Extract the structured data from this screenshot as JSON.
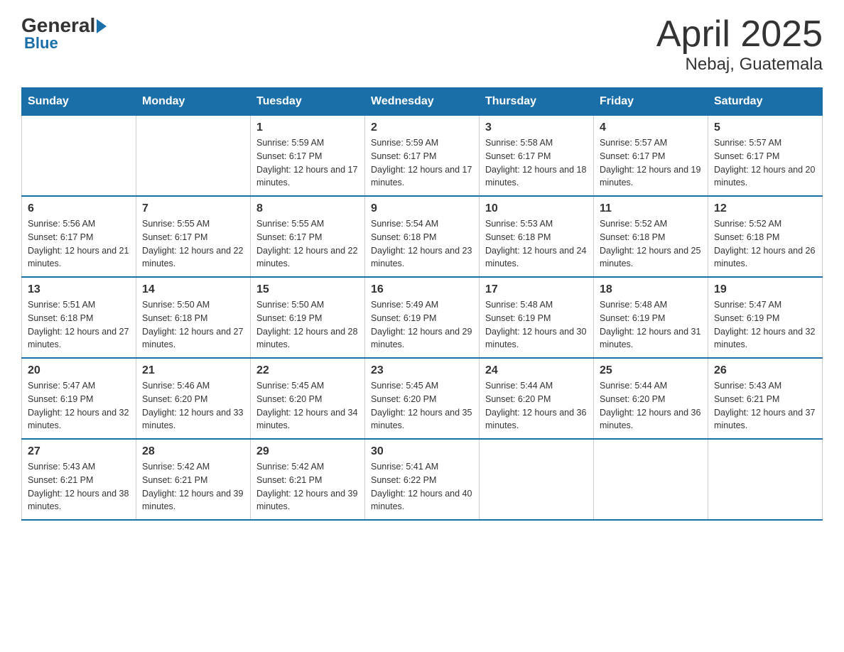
{
  "logo": {
    "general": "General",
    "blue": "Blue",
    "subtitle": "Blue"
  },
  "title": {
    "month": "April 2025",
    "location": "Nebaj, Guatemala"
  },
  "weekdays": [
    "Sunday",
    "Monday",
    "Tuesday",
    "Wednesday",
    "Thursday",
    "Friday",
    "Saturday"
  ],
  "weeks": [
    [
      {
        "day": "",
        "sunrise": "",
        "sunset": "",
        "daylight": ""
      },
      {
        "day": "",
        "sunrise": "",
        "sunset": "",
        "daylight": ""
      },
      {
        "day": "1",
        "sunrise": "Sunrise: 5:59 AM",
        "sunset": "Sunset: 6:17 PM",
        "daylight": "Daylight: 12 hours and 17 minutes."
      },
      {
        "day": "2",
        "sunrise": "Sunrise: 5:59 AM",
        "sunset": "Sunset: 6:17 PM",
        "daylight": "Daylight: 12 hours and 17 minutes."
      },
      {
        "day": "3",
        "sunrise": "Sunrise: 5:58 AM",
        "sunset": "Sunset: 6:17 PM",
        "daylight": "Daylight: 12 hours and 18 minutes."
      },
      {
        "day": "4",
        "sunrise": "Sunrise: 5:57 AM",
        "sunset": "Sunset: 6:17 PM",
        "daylight": "Daylight: 12 hours and 19 minutes."
      },
      {
        "day": "5",
        "sunrise": "Sunrise: 5:57 AM",
        "sunset": "Sunset: 6:17 PM",
        "daylight": "Daylight: 12 hours and 20 minutes."
      }
    ],
    [
      {
        "day": "6",
        "sunrise": "Sunrise: 5:56 AM",
        "sunset": "Sunset: 6:17 PM",
        "daylight": "Daylight: 12 hours and 21 minutes."
      },
      {
        "day": "7",
        "sunrise": "Sunrise: 5:55 AM",
        "sunset": "Sunset: 6:17 PM",
        "daylight": "Daylight: 12 hours and 22 minutes."
      },
      {
        "day": "8",
        "sunrise": "Sunrise: 5:55 AM",
        "sunset": "Sunset: 6:17 PM",
        "daylight": "Daylight: 12 hours and 22 minutes."
      },
      {
        "day": "9",
        "sunrise": "Sunrise: 5:54 AM",
        "sunset": "Sunset: 6:18 PM",
        "daylight": "Daylight: 12 hours and 23 minutes."
      },
      {
        "day": "10",
        "sunrise": "Sunrise: 5:53 AM",
        "sunset": "Sunset: 6:18 PM",
        "daylight": "Daylight: 12 hours and 24 minutes."
      },
      {
        "day": "11",
        "sunrise": "Sunrise: 5:52 AM",
        "sunset": "Sunset: 6:18 PM",
        "daylight": "Daylight: 12 hours and 25 minutes."
      },
      {
        "day": "12",
        "sunrise": "Sunrise: 5:52 AM",
        "sunset": "Sunset: 6:18 PM",
        "daylight": "Daylight: 12 hours and 26 minutes."
      }
    ],
    [
      {
        "day": "13",
        "sunrise": "Sunrise: 5:51 AM",
        "sunset": "Sunset: 6:18 PM",
        "daylight": "Daylight: 12 hours and 27 minutes."
      },
      {
        "day": "14",
        "sunrise": "Sunrise: 5:50 AM",
        "sunset": "Sunset: 6:18 PM",
        "daylight": "Daylight: 12 hours and 27 minutes."
      },
      {
        "day": "15",
        "sunrise": "Sunrise: 5:50 AM",
        "sunset": "Sunset: 6:19 PM",
        "daylight": "Daylight: 12 hours and 28 minutes."
      },
      {
        "day": "16",
        "sunrise": "Sunrise: 5:49 AM",
        "sunset": "Sunset: 6:19 PM",
        "daylight": "Daylight: 12 hours and 29 minutes."
      },
      {
        "day": "17",
        "sunrise": "Sunrise: 5:48 AM",
        "sunset": "Sunset: 6:19 PM",
        "daylight": "Daylight: 12 hours and 30 minutes."
      },
      {
        "day": "18",
        "sunrise": "Sunrise: 5:48 AM",
        "sunset": "Sunset: 6:19 PM",
        "daylight": "Daylight: 12 hours and 31 minutes."
      },
      {
        "day": "19",
        "sunrise": "Sunrise: 5:47 AM",
        "sunset": "Sunset: 6:19 PM",
        "daylight": "Daylight: 12 hours and 32 minutes."
      }
    ],
    [
      {
        "day": "20",
        "sunrise": "Sunrise: 5:47 AM",
        "sunset": "Sunset: 6:19 PM",
        "daylight": "Daylight: 12 hours and 32 minutes."
      },
      {
        "day": "21",
        "sunrise": "Sunrise: 5:46 AM",
        "sunset": "Sunset: 6:20 PM",
        "daylight": "Daylight: 12 hours and 33 minutes."
      },
      {
        "day": "22",
        "sunrise": "Sunrise: 5:45 AM",
        "sunset": "Sunset: 6:20 PM",
        "daylight": "Daylight: 12 hours and 34 minutes."
      },
      {
        "day": "23",
        "sunrise": "Sunrise: 5:45 AM",
        "sunset": "Sunset: 6:20 PM",
        "daylight": "Daylight: 12 hours and 35 minutes."
      },
      {
        "day": "24",
        "sunrise": "Sunrise: 5:44 AM",
        "sunset": "Sunset: 6:20 PM",
        "daylight": "Daylight: 12 hours and 36 minutes."
      },
      {
        "day": "25",
        "sunrise": "Sunrise: 5:44 AM",
        "sunset": "Sunset: 6:20 PM",
        "daylight": "Daylight: 12 hours and 36 minutes."
      },
      {
        "day": "26",
        "sunrise": "Sunrise: 5:43 AM",
        "sunset": "Sunset: 6:21 PM",
        "daylight": "Daylight: 12 hours and 37 minutes."
      }
    ],
    [
      {
        "day": "27",
        "sunrise": "Sunrise: 5:43 AM",
        "sunset": "Sunset: 6:21 PM",
        "daylight": "Daylight: 12 hours and 38 minutes."
      },
      {
        "day": "28",
        "sunrise": "Sunrise: 5:42 AM",
        "sunset": "Sunset: 6:21 PM",
        "daylight": "Daylight: 12 hours and 39 minutes."
      },
      {
        "day": "29",
        "sunrise": "Sunrise: 5:42 AM",
        "sunset": "Sunset: 6:21 PM",
        "daylight": "Daylight: 12 hours and 39 minutes."
      },
      {
        "day": "30",
        "sunrise": "Sunrise: 5:41 AM",
        "sunset": "Sunset: 6:22 PM",
        "daylight": "Daylight: 12 hours and 40 minutes."
      },
      {
        "day": "",
        "sunrise": "",
        "sunset": "",
        "daylight": ""
      },
      {
        "day": "",
        "sunrise": "",
        "sunset": "",
        "daylight": ""
      },
      {
        "day": "",
        "sunrise": "",
        "sunset": "",
        "daylight": ""
      }
    ]
  ]
}
